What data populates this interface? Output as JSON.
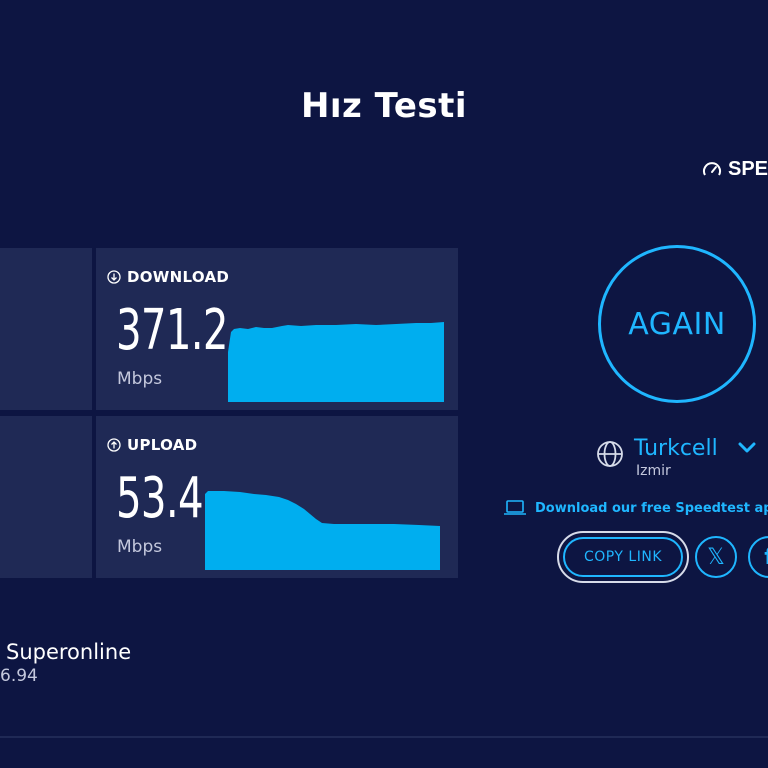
{
  "page": {
    "title": "Hız Testi"
  },
  "header": {
    "brand_label": "SPE",
    "brand_icon": "speedometer-icon"
  },
  "download": {
    "label": "DOWNLOAD",
    "value": "371.2",
    "unit": "Mbps",
    "icon": "arrow-down-circle-icon"
  },
  "upload": {
    "label": "UPLOAD",
    "value": "53.4",
    "unit": "Mbps",
    "icon": "arrow-up-circle-icon"
  },
  "action": {
    "again_label": "AGAIN"
  },
  "isp": {
    "name": "Turkcell",
    "location": "Izmir",
    "icon": "globe-icon"
  },
  "app_promo": {
    "text": "Download our free Speedtest app",
    "icon": "laptop-icon"
  },
  "share": {
    "copy_label": "COPY LINK",
    "x_icon": "x-logo-icon",
    "facebook_icon": "facebook-icon"
  },
  "server": {
    "provider": "Superonline",
    "ip_fragment": "6.94"
  },
  "colors": {
    "background": "#0d1542",
    "panel": "#1f2955",
    "accent": "#1fb6ff",
    "graph": "#00aeef"
  }
}
